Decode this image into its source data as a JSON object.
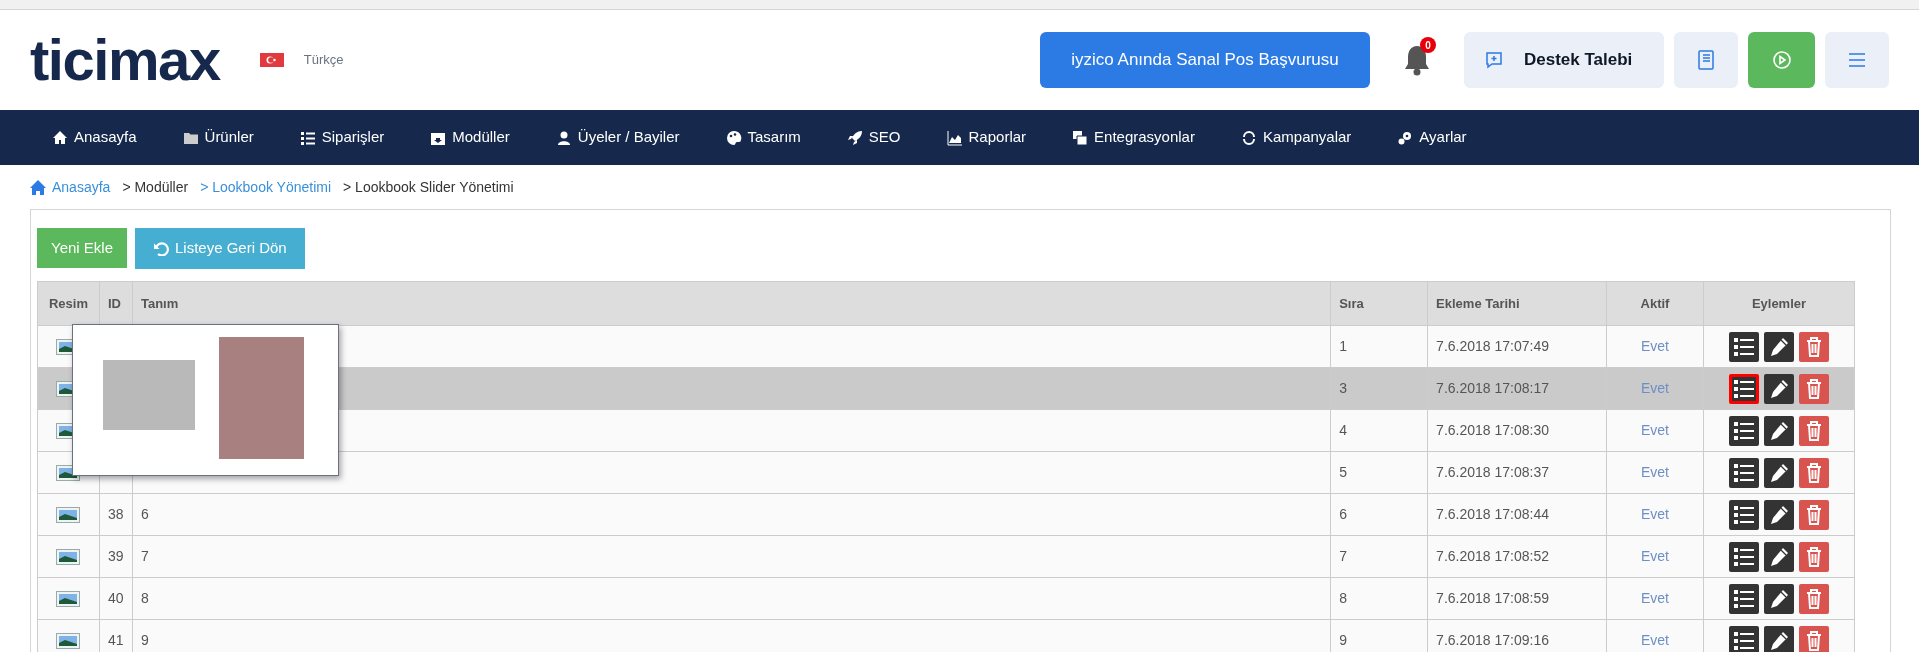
{
  "header": {
    "logo": "ticimax",
    "language": "Türkçe",
    "promo_button": "iyzico Anında Sanal Pos Başvurusu",
    "notification_count": "0",
    "support_button": "Destek Talebi"
  },
  "nav": [
    "Anasayfa",
    "Ürünler",
    "Siparişler",
    "Modüller",
    "Üyeler / Bayiler",
    "Tasarım",
    "SEO",
    "Raporlar",
    "Entegrasyonlar",
    "Kampanyalar",
    "Ayarlar"
  ],
  "breadcrumb": [
    {
      "label": "Anasayfa",
      "link": true
    },
    {
      "label": "> Modüller",
      "link": false
    },
    {
      "label": "> Lookbook Yönetimi",
      "link": true
    },
    {
      "label": "> Lookbook Slider Yönetimi",
      "link": false
    }
  ],
  "toolbar": {
    "add_button": "Yeni Ekle",
    "back_button": "Listeye Geri Dön"
  },
  "table": {
    "columns": [
      "Resim",
      "ID",
      "Tanım",
      "Sıra",
      "Ekleme Tarihi",
      "Aktif",
      "Eylemler"
    ],
    "rows": [
      {
        "sira": "1",
        "date": "7.6.2018 17:07:49",
        "aktif": "Evet",
        "selected": false
      },
      {
        "sira": "3",
        "date": "7.6.2018 17:08:17",
        "aktif": "Evet",
        "selected": true
      },
      {
        "sira": "4",
        "date": "7.6.2018 17:08:30",
        "aktif": "Evet",
        "selected": false
      },
      {
        "sira": "5",
        "date": "7.6.2018 17:08:37",
        "aktif": "Evet",
        "selected": false
      },
      {
        "id": "38",
        "tanim": "6",
        "sira": "6",
        "date": "7.6.2018 17:08:44",
        "aktif": "Evet",
        "selected": false
      },
      {
        "id": "39",
        "tanim": "7",
        "sira": "7",
        "date": "7.6.2018 17:08:52",
        "aktif": "Evet",
        "selected": false
      },
      {
        "id": "40",
        "tanim": "8",
        "sira": "8",
        "date": "7.6.2018 17:08:59",
        "aktif": "Evet",
        "selected": false
      },
      {
        "id": "41",
        "tanim": "9",
        "sira": "9",
        "date": "7.6.2018 17:09:16",
        "aktif": "Evet",
        "selected": false
      }
    ]
  }
}
